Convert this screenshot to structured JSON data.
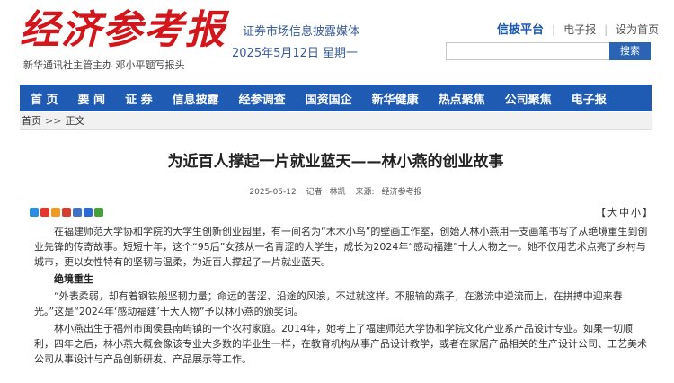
{
  "header": {
    "logo_text": "经济参考报",
    "logo_sub": "新华通讯社主管主办  邓小平题写报头",
    "slogan": "证券市场信息披露媒体",
    "date": "2025年5月12日  星期一",
    "toplinks": [
      "信披平台",
      "电子报",
      "设为首页"
    ],
    "search_placeholder": "",
    "search_button": "搜索"
  },
  "nav": [
    "首 页",
    "要 闻",
    "证 券",
    "信息披露",
    "经参调查",
    "国资国企",
    "新华健康",
    "热点聚焦",
    "公司聚焦",
    "电子报"
  ],
  "breadcrumb": [
    "首页",
    "正文"
  ],
  "breadcrumb_sep": ">>",
  "article": {
    "title": "为近百人撑起一片就业蓝天——林小燕的创业故事",
    "date": "2025-05-12",
    "reporter_label": "记者",
    "reporter": "林凯",
    "source_label": "来源:",
    "source": "经济参考报",
    "fontsize_label": [
      "【",
      "大",
      "中",
      "小",
      "】"
    ],
    "paragraphs": [
      {
        "type": "text",
        "text": "在福建师范大学协和学院的大学生创新创业园里，有一间名为“木木小鸟”的壁画工作室，创始人林小燕用一支画笔书写了从绝境重生到创业先锋的传奇故事。短短十年，这个“95后”女孩从一名青涩的大学生，成长为2024年“感动福建”十大人物之一。她不仅用艺术点亮了乡村与城市，更以女性特有的坚韧与温柔，为近百人撑起了一片就业蓝天。"
      },
      {
        "type": "sub",
        "text": "绝境重生"
      },
      {
        "type": "text",
        "text": "“外表柔弱，却有着钢铁般坚韧力量；命运的苦涩、沿途的风浪，不过就这样。不服输的燕子，在激流中逆流而上，在拼搏中迎来春光。”这是“2024年‘感动福建’十大人物”予以林小燕的颁奖词。"
      },
      {
        "type": "text",
        "text": "林小燕出生于福州市闽侯县南屿镇的一个农村家庭。2014年，她考上了福建师范大学协和学院文化产业系产品设计专业。如果一切顺利，四年之后，林小燕大概会像该专业大多数的毕业生一样，在教育机构从事产品设计教学，或者在家居产品相关的生产设计公司、工艺美术公司从事设计与产品创新研发、产品展示等工作。"
      }
    ]
  },
  "share_icons": [
    {
      "name": "qzone-icon",
      "color": "#2a8fe0"
    },
    {
      "name": "sina-weibo-icon",
      "color": "#e6362c"
    },
    {
      "name": "tencent-weibo-icon",
      "color": "#f19a1f"
    },
    {
      "name": "renren-icon",
      "color": "#d43d2f"
    },
    {
      "name": "kaixin-icon",
      "color": "#3d74c6"
    },
    {
      "name": "baidu-icon",
      "color": "#2d6ad3"
    },
    {
      "name": "wechat-icon",
      "color": "#47a13a"
    }
  ],
  "colors": {
    "brand_red": "#d2161b",
    "nav_blue": "#1f5bb3",
    "link_blue": "#1d5ab0"
  }
}
